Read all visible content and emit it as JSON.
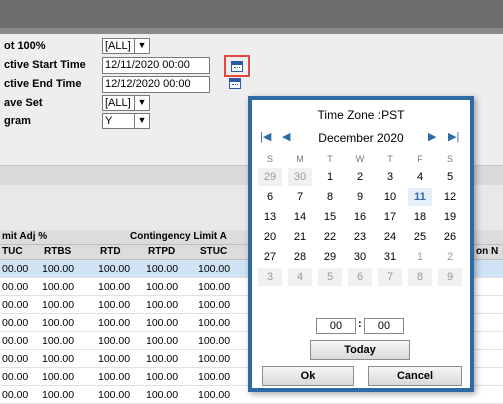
{
  "form": {
    "fields": [
      {
        "label": "ot 100%",
        "value": "[ALL]",
        "kind": "select"
      },
      {
        "label": "ctive Start Time",
        "value": "12/11/2020 00:00",
        "kind": "text"
      },
      {
        "label": "ctive End Time",
        "value": "12/12/2020 00:00",
        "kind": "text"
      },
      {
        "label": "ave Set",
        "value": "[ALL]",
        "kind": "select"
      },
      {
        "label": "gram",
        "value": "Y",
        "kind": "select"
      }
    ]
  },
  "grid": {
    "group_headers": [
      "mit Adj %",
      "Contingency Limit A"
    ],
    "columns": [
      "TUC",
      "RTBS",
      "RTD",
      "RTPD",
      "STUC"
    ],
    "extra_column": "on N",
    "rows": [
      [
        "00.00",
        "100.00",
        "100.00",
        "100.00",
        "100.00"
      ],
      [
        "00.00",
        "100.00",
        "100.00",
        "100.00",
        "100.00"
      ],
      [
        "00.00",
        "100.00",
        "100.00",
        "100.00",
        "100.00"
      ],
      [
        "00.00",
        "100.00",
        "100.00",
        "100.00",
        "100.00"
      ],
      [
        "00.00",
        "100.00",
        "100.00",
        "100.00",
        "100.00"
      ],
      [
        "00.00",
        "100.00",
        "100.00",
        "100.00",
        "100.00"
      ],
      [
        "00.00",
        "100.00",
        "100.00",
        "100.00",
        "100.00"
      ],
      [
        "00.00",
        "100.00",
        "100.00",
        "100.00",
        "100.00"
      ]
    ]
  },
  "calendar": {
    "timezone": "Time Zone :PST",
    "month": "December 2020",
    "dow": [
      "S",
      "M",
      "T",
      "W",
      "T",
      "F",
      "S"
    ],
    "weeks": [
      [
        "29",
        "30",
        "1",
        "2",
        "3",
        "4",
        "5"
      ],
      [
        "6",
        "7",
        "8",
        "9",
        "10",
        "11",
        "12"
      ],
      [
        "13",
        "14",
        "15",
        "16",
        "17",
        "18",
        "19"
      ],
      [
        "20",
        "21",
        "22",
        "23",
        "24",
        "25",
        "26"
      ],
      [
        "27",
        "28",
        "29",
        "30",
        "31",
        "1",
        "2"
      ],
      [
        "3",
        "4",
        "5",
        "6",
        "7",
        "8",
        "9"
      ]
    ],
    "hour": "00",
    "minute": "00",
    "today_label": "Today",
    "ok_label": "Ok",
    "cancel_label": "Cancel",
    "nav": {
      "first": "|◀",
      "prev": "◀",
      "next": "▶",
      "last": "▶|"
    },
    "selected_day": "11"
  },
  "colors": {
    "accent": "#2f6aa3",
    "highlight": "#e8453c"
  }
}
